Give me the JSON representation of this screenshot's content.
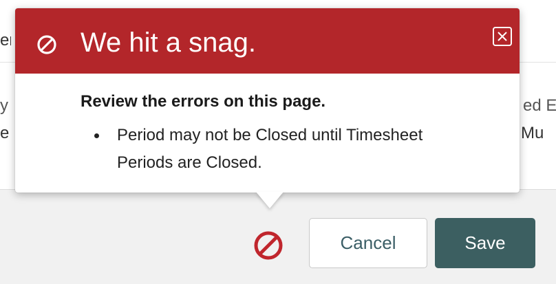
{
  "background": {
    "fragment_1": "er",
    "fragment_2": "y",
    "fragment_3": "e",
    "fragment_4": "ed E",
    "fragment_5": "Mu"
  },
  "popover": {
    "title": "We hit a snag.",
    "heading": "Review the errors on this page.",
    "errors": [
      "Period may not be Closed until Timesheet Periods are Closed."
    ],
    "header_color": "#b3262a"
  },
  "icons": {
    "header": "prohibited-icon",
    "close": "close-icon",
    "indicator": "prohibited-icon"
  },
  "footer": {
    "cancel_label": "Cancel",
    "save_label": "Save",
    "save_color": "#3c5f61",
    "indicator_color": "#c0262d"
  }
}
